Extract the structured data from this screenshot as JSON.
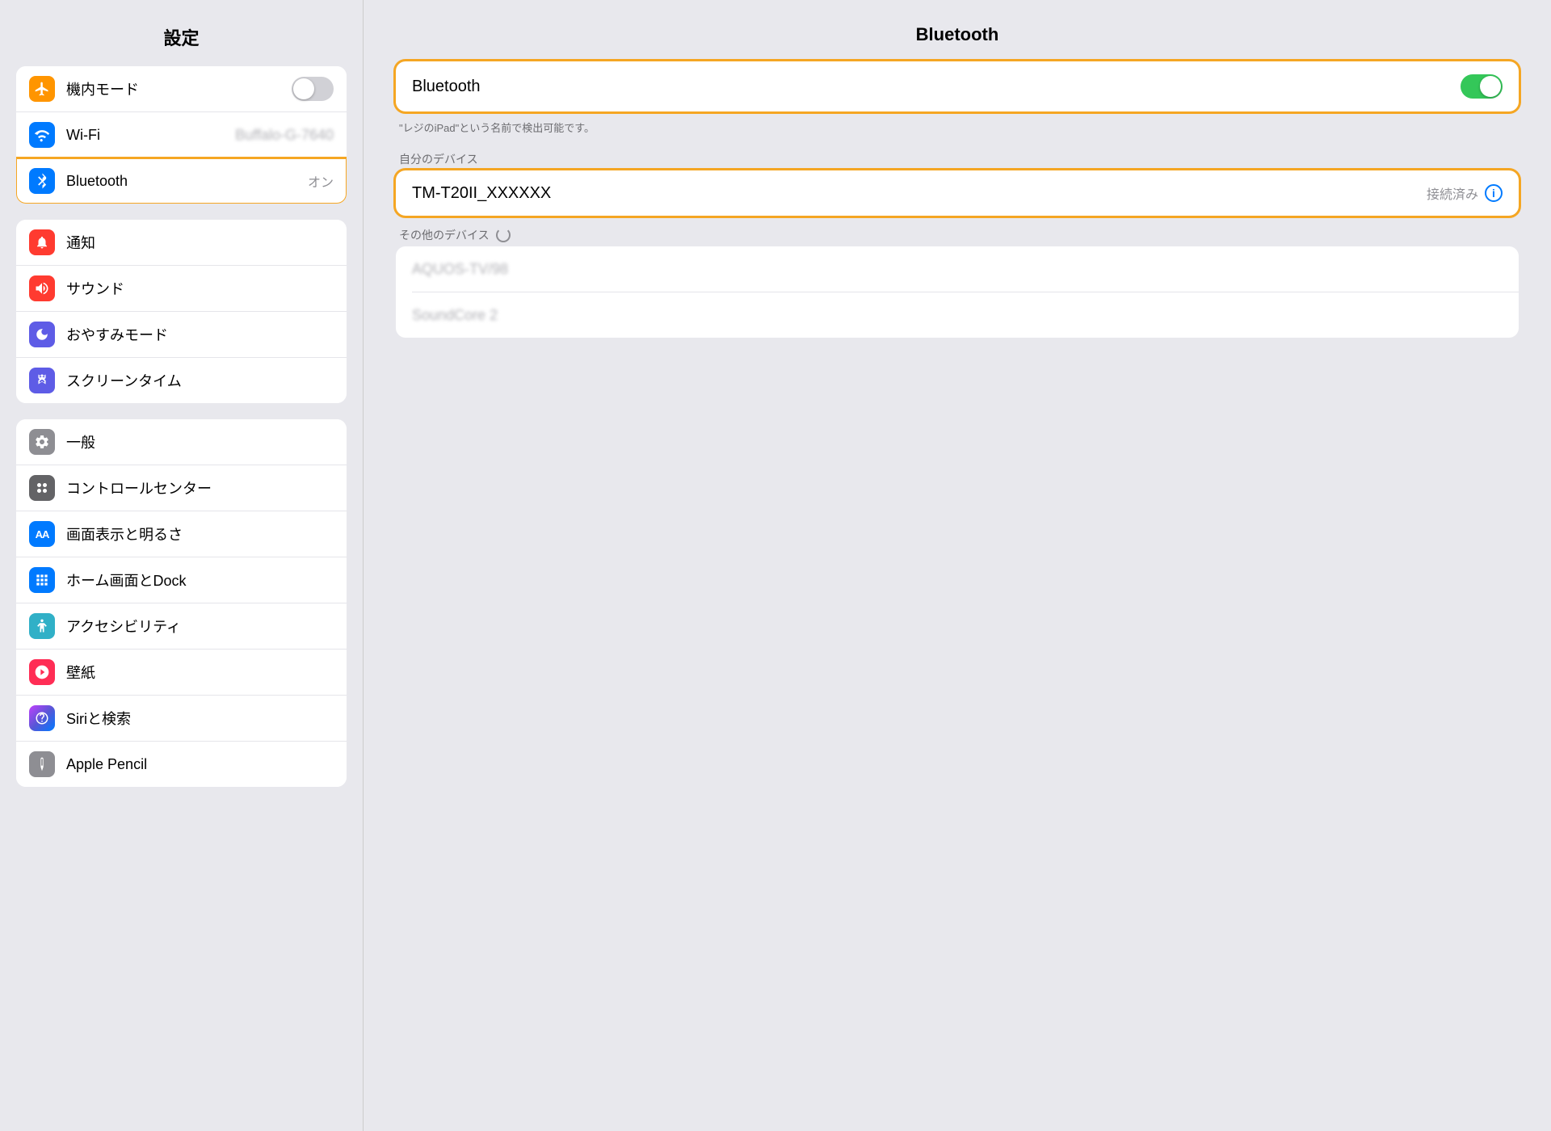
{
  "sidebar": {
    "title": "設定",
    "groups": [
      {
        "id": "group1",
        "items": [
          {
            "id": "airplane",
            "label": "機内モード",
            "icon_type": "airplane",
            "icon_bg": "orange",
            "value": "toggle_off",
            "active": false
          },
          {
            "id": "wifi",
            "label": "Wi-Fi",
            "icon_type": "wifi",
            "icon_bg": "blue",
            "value": "Buffalo-G-7640",
            "active": false
          },
          {
            "id": "bluetooth",
            "label": "Bluetooth",
            "icon_type": "bluetooth",
            "icon_bg": "blue",
            "value": "オン",
            "active": true
          }
        ]
      },
      {
        "id": "group2",
        "items": [
          {
            "id": "notification",
            "label": "通知",
            "icon_type": "bell",
            "icon_bg": "red",
            "value": "",
            "active": false
          },
          {
            "id": "sound",
            "label": "サウンド",
            "icon_type": "sound",
            "icon_bg": "red2",
            "value": "",
            "active": false
          },
          {
            "id": "donotdisturb",
            "label": "おやすみモード",
            "icon_type": "moon",
            "icon_bg": "purple",
            "value": "",
            "active": false
          },
          {
            "id": "screentime",
            "label": "スクリーンタイム",
            "icon_type": "hourglass",
            "icon_bg": "purple2",
            "value": "",
            "active": false
          }
        ]
      },
      {
        "id": "group3",
        "items": [
          {
            "id": "general",
            "label": "一般",
            "icon_type": "gear",
            "icon_bg": "gray",
            "value": "",
            "active": false
          },
          {
            "id": "controlcenter",
            "label": "コントロールセンター",
            "icon_type": "cc",
            "icon_bg": "gray2",
            "value": "",
            "active": false
          },
          {
            "id": "display",
            "label": "画面表示と明るさ",
            "icon_type": "aa",
            "icon_bg": "blue2",
            "value": "",
            "active": false
          },
          {
            "id": "homescreen",
            "label": "ホーム画面とDock",
            "icon_type": "home",
            "icon_bg": "blue3",
            "value": "",
            "active": false
          },
          {
            "id": "accessibility",
            "label": "アクセシビリティ",
            "icon_type": "access",
            "icon_bg": "teal",
            "value": "",
            "active": false
          },
          {
            "id": "wallpaper",
            "label": "壁紙",
            "icon_type": "flower",
            "icon_bg": "pink",
            "value": "",
            "active": false
          },
          {
            "id": "siri",
            "label": "Siriと検索",
            "icon_type": "siri",
            "icon_bg": "gradient",
            "value": "",
            "active": false
          },
          {
            "id": "appencil",
            "label": "Apple Pencil",
            "icon_type": "pencil",
            "icon_bg": "apencil",
            "value": "",
            "active": false
          }
        ]
      }
    ]
  },
  "main": {
    "title": "Bluetooth",
    "bluetooth_label": "Bluetooth",
    "bluetooth_on": true,
    "discover_text": "\"レジのiPad\"という名前で検出可能です。",
    "my_devices_label": "自分のデバイス",
    "connected_device": "TM-T20II_XXXXXX",
    "connected_status": "接続済み",
    "other_devices_label": "その他のデバイス",
    "other_device_1": "AQUOS-TV/98",
    "other_device_2": "SoundCore 2"
  }
}
